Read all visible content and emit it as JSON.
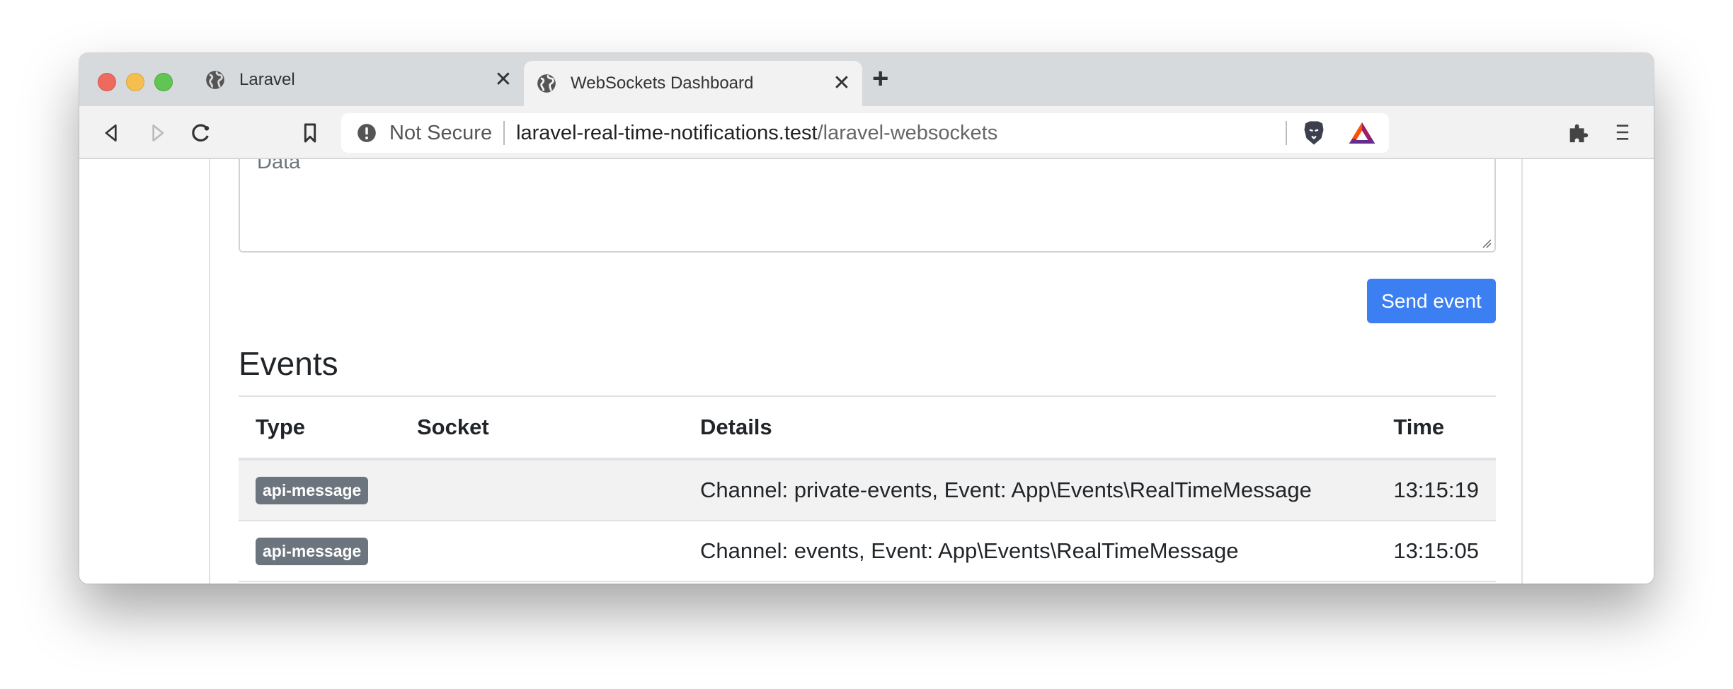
{
  "browser": {
    "tabs": [
      {
        "title": "Laravel",
        "icon": "globe-icon",
        "active": false
      },
      {
        "title": "WebSockets Dashboard",
        "icon": "globe-icon",
        "active": true
      }
    ],
    "new_tab_icon": "plus-icon",
    "address": {
      "security_label": "Not Secure",
      "url_host": "laravel-real-time-notifications.test",
      "url_path": "/laravel-websockets"
    },
    "toolbar_icons": [
      "back-icon",
      "forward-icon",
      "reload-icon",
      "bookmark-icon",
      "brave-shields-icon",
      "brave-rewards-icon",
      "extensions-icon",
      "menu-icon"
    ]
  },
  "form": {
    "data_placeholder": "Data",
    "data_value": "",
    "send_label": "Send event"
  },
  "events": {
    "title": "Events",
    "columns": [
      "Type",
      "Socket",
      "Details",
      "Time"
    ],
    "rows": [
      {
        "type": "api-message",
        "socket": "",
        "details": "Channel: private-events, Event: App\\Events\\RealTimeMessage",
        "time": "13:15:19"
      },
      {
        "type": "api-message",
        "socket": "",
        "details": "Channel: events, Event: App\\Events\\RealTimeMessage",
        "time": "13:15:05"
      }
    ]
  },
  "colors": {
    "primary": "#3b7ff2",
    "badge": "#6c757d"
  }
}
